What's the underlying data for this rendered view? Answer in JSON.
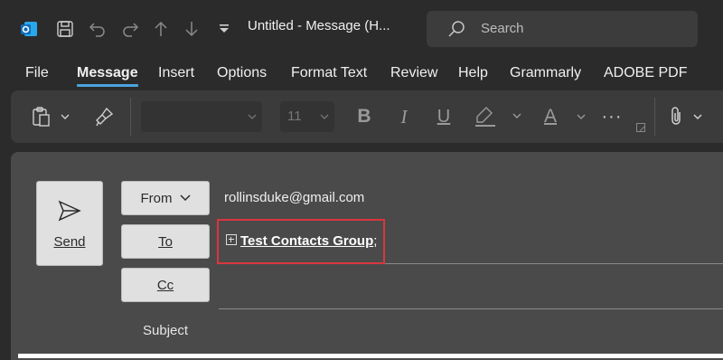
{
  "titlebar": {
    "title": "Untitled  -  Message (H...",
    "search_placeholder": "Search",
    "icons": [
      "outlook-app-icon",
      "save-icon",
      "undo-icon",
      "redo-icon",
      "up-arrow-icon",
      "down-arrow-icon",
      "customize-toolbar-icon"
    ]
  },
  "menu": {
    "items": [
      "File",
      "Message",
      "Insert",
      "Options",
      "Format Text",
      "Review",
      "Help",
      "Grammarly",
      "ADOBE PDF"
    ],
    "active": "Message"
  },
  "ribbon": {
    "font_size": "11",
    "bold_label": "B",
    "italic_label": "I",
    "underline_label": "U",
    "font_color_label": "A",
    "more_label": "···"
  },
  "compose": {
    "send_label": "Send",
    "from_label": "From",
    "from_value": "rollinsduke@gmail.com",
    "to_label": "To",
    "to_recipient": "Test Contacts Group",
    "to_separator": ";",
    "cc_label": "Cc",
    "subject_label": "Subject"
  },
  "colors": {
    "accent_underline": "#4aa3df",
    "highlight_border": "#d9363e",
    "outlook_blue": "#0f6cbd"
  }
}
